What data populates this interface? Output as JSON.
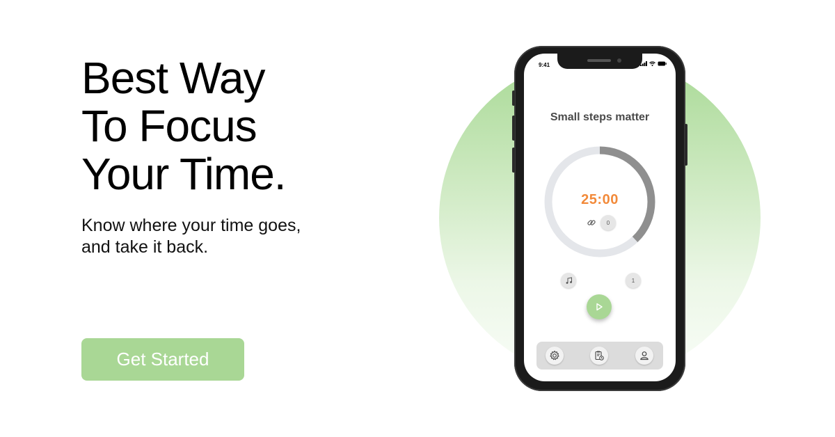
{
  "hero": {
    "headline_lines": [
      "Best Way",
      "To Focus",
      "Your Time."
    ],
    "subtitle_lines": [
      "Know where your time goes,",
      "and take it back."
    ],
    "cta_label": "Get Started"
  },
  "phone": {
    "status_time": "9:41",
    "app_title": "Small steps matter",
    "timer_value": "25:00",
    "timer_progress": 0.38,
    "task_badge": "0",
    "session_count": "1",
    "tabs": [
      "settings",
      "tasks",
      "profile"
    ]
  },
  "colors": {
    "accent_green": "#a9d795",
    "timer_orange": "#f28a3a",
    "ring_track": "#e4e6ea",
    "ring_progress": "#8f8f8f"
  },
  "icons": {
    "link": "link-icon",
    "music": "music-note-icon",
    "play": "play-icon",
    "settings": "gear-icon",
    "tasks": "clipboard-timer-icon",
    "profile": "user-icon"
  }
}
